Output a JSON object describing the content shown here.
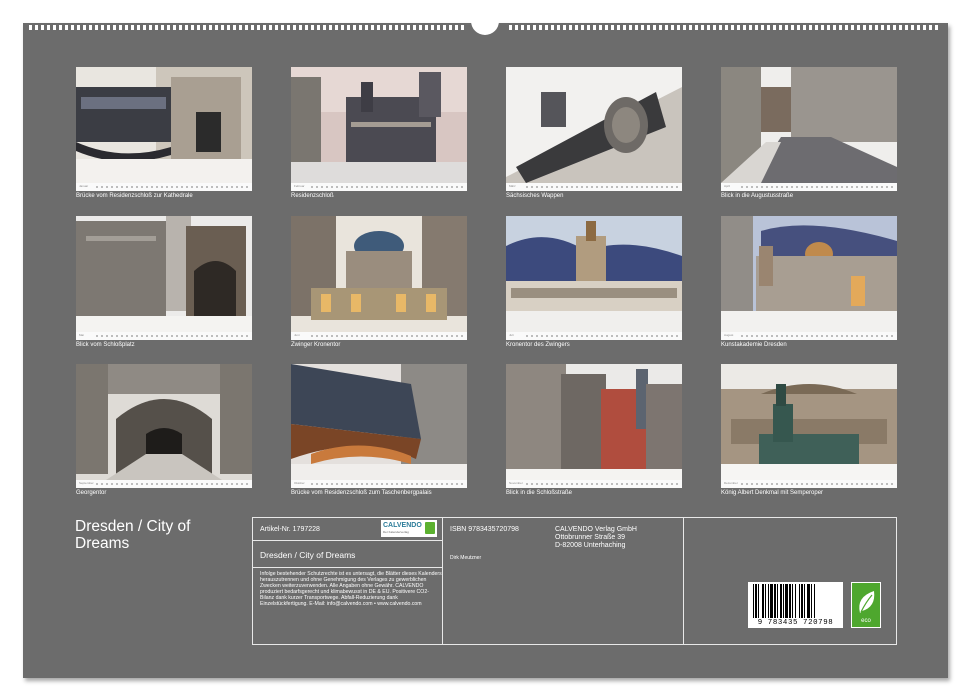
{
  "calendar": {
    "title": "Dresden / City of Dreams"
  },
  "photos": [
    {
      "month": "Januar",
      "caption": "Brücke vom Residenzschloß zur Kathedrale"
    },
    {
      "month": "Februar",
      "caption": "Residenzschloß"
    },
    {
      "month": "März",
      "caption": "Sächsisches Wappen"
    },
    {
      "month": "April",
      "caption": "Blick in die Augustusstraße"
    },
    {
      "month": "Mai",
      "caption": "Blick vom Schloßplatz"
    },
    {
      "month": "Juni",
      "caption": "Zwinger Kronentor"
    },
    {
      "month": "Juli",
      "caption": "Kronentor des Zwingers"
    },
    {
      "month": "August",
      "caption": "Kunstakademie Dresden"
    },
    {
      "month": "September",
      "caption": "Georgentor"
    },
    {
      "month": "Oktober",
      "caption": "Brücke vom Residenzschloß zum Taschenbergpalais"
    },
    {
      "month": "November",
      "caption": "Blick in die Schloßstraße"
    },
    {
      "month": "Dezember",
      "caption": "König Albert Denkmal mit Semperoper"
    }
  ],
  "info": {
    "article": "Artikel-Nr. 1797228",
    "logo_text": "CALVENDO",
    "logo_sub": "Der Kalenderverlag",
    "title": "Dresden / City of Dreams",
    "legal": "Infolge bestehender Schutzrechte ist es untersagt, die Blätter dieses Kalenders herauszutrennen und ohne Genehmigung des Verlages zu gewerblichen Zwecken weiterzuverwenden. Alle Angaben ohne Gewähr. CALVENDO produziert bedarfsgerecht und klimabewusst in DE & EU. Positivere CO2-Bilanz dank kurzer Transportwege. Abfall-Reduzierung dank Einzelstückfertigung. E-Mail: info@calvendo.com • www.calvendo.com",
    "isbn": "ISBN 9783435720798",
    "author": "Dirk Meutzner",
    "publisher_name": "CALVENDO Verlag GmbH",
    "publisher_street": "Ottobrunner Straße 39",
    "publisher_city": "D-82008 Unterhaching",
    "barcode_digits": "9 783435 720798",
    "eco_label": "eco"
  },
  "colors": {
    "background": "#6c6c6c",
    "text": "#ffffff",
    "eco_green": "#4ea72e"
  }
}
